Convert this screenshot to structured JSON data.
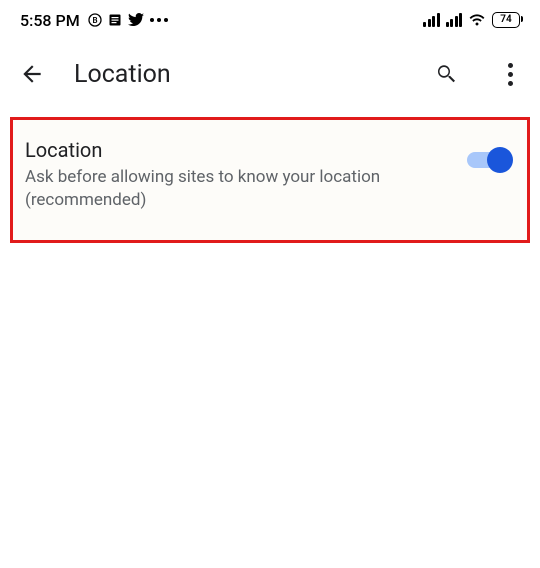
{
  "status": {
    "time": "5:58 PM",
    "battery": "74"
  },
  "appbar": {
    "title": "Location"
  },
  "setting": {
    "title": "Location",
    "subtitle": "Ask before allowing sites to know your location (recommended)",
    "toggle_on": true
  }
}
